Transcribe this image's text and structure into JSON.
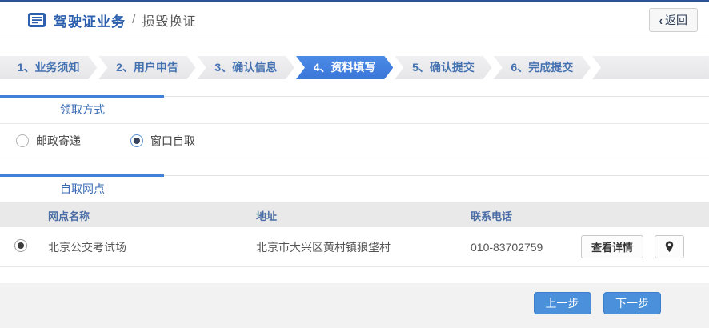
{
  "header": {
    "title": "驾驶证业务",
    "separator": "/",
    "subtitle": "损毁换证",
    "back_icon": "‹",
    "back_label": "返回"
  },
  "steps": {
    "items": [
      {
        "label": "1、业务须知",
        "active": false
      },
      {
        "label": "2、用户申告",
        "active": false
      },
      {
        "label": "3、确认信息",
        "active": false
      },
      {
        "label": "4、资料填写",
        "active": true
      },
      {
        "label": "5、确认提交",
        "active": false
      },
      {
        "label": "6、完成提交",
        "active": false
      }
    ]
  },
  "pickup_method": {
    "title": "领取方式",
    "options": [
      {
        "label": "邮政寄递",
        "selected": false
      },
      {
        "label": "窗口自取",
        "selected": true
      }
    ]
  },
  "pickup_outlets": {
    "title": "自取网点",
    "columns": [
      "网点名称",
      "地址",
      "联系电话"
    ],
    "rows": [
      {
        "selected": true,
        "name": "北京公交考试场",
        "address": "北京市大兴区黄村镇狼垡村",
        "phone": "010-83702759",
        "detail_label": "查看详情",
        "pin_icon": "map-pin"
      }
    ]
  },
  "footer": {
    "prev_label": "上一步",
    "next_label": "下一步"
  },
  "colors": {
    "top_bar": "#2a5294",
    "accent_blue": "#4080d8",
    "active_step_blue": "#3e80e0",
    "link_blue": "#3a6cb4",
    "button_blue": "#4a90db",
    "table_header_bg": "#e9e9e9"
  }
}
